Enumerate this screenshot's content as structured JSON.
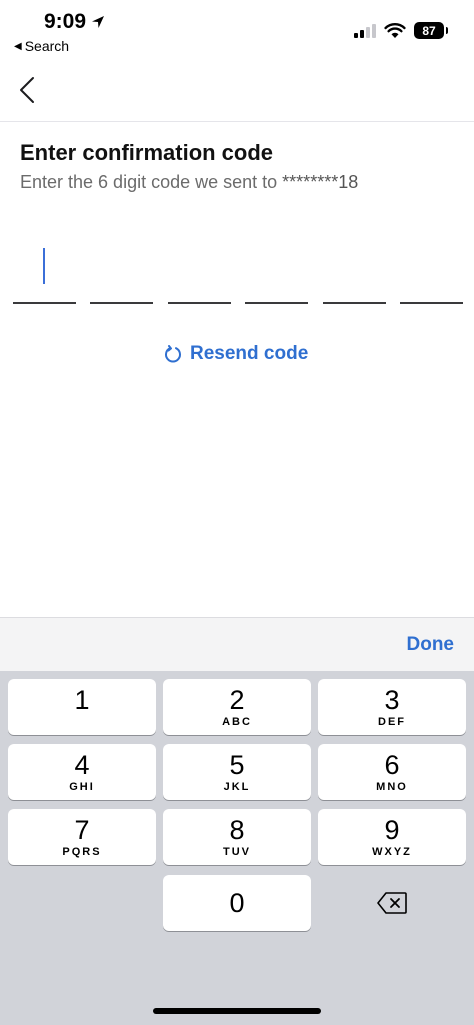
{
  "status_bar": {
    "time": "9:09",
    "back_app": "Search",
    "battery": "87"
  },
  "screen": {
    "title": "Enter confirmation code",
    "subtitle_prefix": "Enter the 6 digit code we sent to ",
    "masked_number": "********18",
    "code_slots": [
      "",
      "",
      "",
      "",
      "",
      ""
    ],
    "resend_label": "Resend code"
  },
  "keyboard": {
    "done_label": "Done",
    "keys": [
      {
        "num": "1",
        "letters": ""
      },
      {
        "num": "2",
        "letters": "ABC"
      },
      {
        "num": "3",
        "letters": "DEF"
      },
      {
        "num": "4",
        "letters": "GHI"
      },
      {
        "num": "5",
        "letters": "JKL"
      },
      {
        "num": "6",
        "letters": "MNO"
      },
      {
        "num": "7",
        "letters": "PQRS"
      },
      {
        "num": "8",
        "letters": "TUV"
      },
      {
        "num": "9",
        "letters": "WXYZ"
      },
      {
        "num": "0",
        "letters": ""
      }
    ]
  },
  "colors": {
    "accent": "#2f6fd0",
    "cursor": "#3b6fd8",
    "keyboard_bg": "#d1d3d9"
  },
  "icons": {
    "location": "location-arrow-icon",
    "signal": "cellular-signal-icon",
    "wifi": "wifi-icon",
    "back": "chevron-left-icon",
    "resend": "refresh-icon",
    "delete": "backspace-icon"
  }
}
